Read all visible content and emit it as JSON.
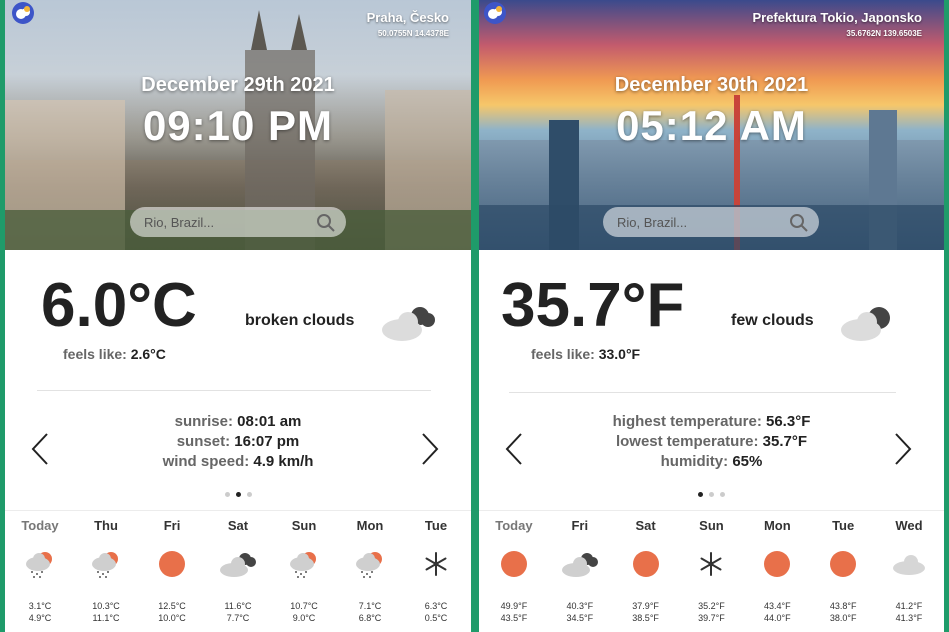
{
  "cards": [
    {
      "location": {
        "city": "Praha, Česko",
        "coords": "50.0755N 14.4378E"
      },
      "date": "December 29th 2021",
      "time": "09:10 PM",
      "search_placeholder": "Rio, Brazil...",
      "current": {
        "temp": "6.0°C",
        "description": "broken clouds",
        "feels_label": "feels like: ",
        "feels_value": "2.6°C",
        "icon": "broken-clouds-icon"
      },
      "slide": [
        {
          "label": "sunrise: ",
          "value": "08:01 am"
        },
        {
          "label": "sunset: ",
          "value": "16:07 pm"
        },
        {
          "label": "wind speed: ",
          "value": "4.9 km/h"
        }
      ],
      "active_dot": 1,
      "forecast": [
        {
          "day": "Today",
          "icon": "rain-sun-icon",
          "hi": "3.1°C",
          "lo": "4.9°C"
        },
        {
          "day": "Thu",
          "icon": "rain-sun-icon",
          "hi": "10.3°C",
          "lo": "11.1°C"
        },
        {
          "day": "Fri",
          "icon": "sun-icon",
          "hi": "12.5°C",
          "lo": "10.0°C"
        },
        {
          "day": "Sat",
          "icon": "broken-clouds-icon",
          "hi": "11.6°C",
          "lo": "7.7°C"
        },
        {
          "day": "Sun",
          "icon": "rain-sun-icon",
          "hi": "10.7°C",
          "lo": "9.0°C"
        },
        {
          "day": "Mon",
          "icon": "rain-sun-icon",
          "hi": "7.1°C",
          "lo": "6.8°C"
        },
        {
          "day": "Tue",
          "icon": "snow-icon",
          "hi": "6.3°C",
          "lo": "0.5°C"
        }
      ]
    },
    {
      "location": {
        "city": "Prefektura Tokio, Japonsko",
        "coords": "35.6762N 139.6503E"
      },
      "date": "December 30th 2021",
      "time": "05:12 AM",
      "search_placeholder": "Rio, Brazil...",
      "current": {
        "temp": "35.7°F",
        "description": "few clouds",
        "feels_label": "feels like: ",
        "feels_value": "33.0°F",
        "icon": "few-clouds-icon"
      },
      "slide": [
        {
          "label": "highest temperature: ",
          "value": "56.3°F"
        },
        {
          "label": "lowest temperature: ",
          "value": "35.7°F"
        },
        {
          "label": "humidity: ",
          "value": "65%"
        }
      ],
      "active_dot": 0,
      "forecast": [
        {
          "day": "Today",
          "icon": "sun-icon",
          "hi": "49.9°F",
          "lo": "43.5°F"
        },
        {
          "day": "Fri",
          "icon": "broken-clouds-icon",
          "hi": "40.3°F",
          "lo": "34.5°F"
        },
        {
          "day": "Sat",
          "icon": "sun-icon",
          "hi": "37.9°F",
          "lo": "38.5°F"
        },
        {
          "day": "Sun",
          "icon": "snow-icon",
          "hi": "35.2°F",
          "lo": "39.7°F"
        },
        {
          "day": "Mon",
          "icon": "sun-icon",
          "hi": "43.4°F",
          "lo": "44.0°F"
        },
        {
          "day": "Tue",
          "icon": "sun-icon",
          "hi": "43.8°F",
          "lo": "38.0°F"
        },
        {
          "day": "Wed",
          "icon": "cloud-icon",
          "hi": "41.2°F",
          "lo": "41.3°F"
        }
      ]
    }
  ],
  "colors": {
    "background": "#1f9b6a",
    "sun": "#e8704a",
    "cloud": "#cfcfcf",
    "dark_cloud": "#444444"
  }
}
